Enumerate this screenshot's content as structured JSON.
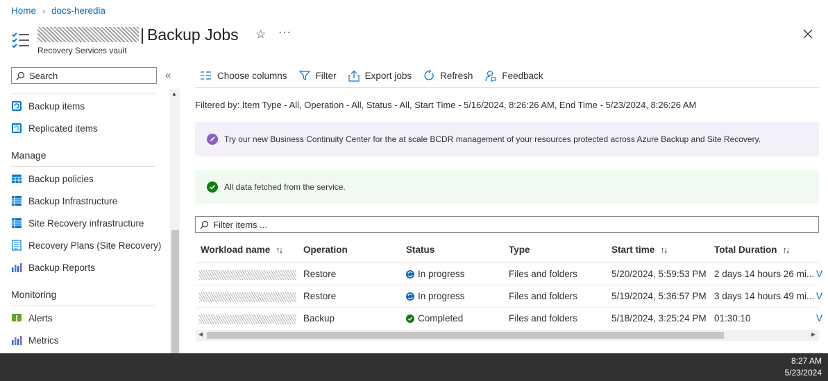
{
  "breadcrumb": {
    "home": "Home",
    "vault": "docs-heredia"
  },
  "header": {
    "title": "Backup Jobs",
    "separator": "|",
    "subtitle": "Recovery Services vault",
    "star_icon": "star-icon",
    "more_label": "···"
  },
  "sidebar": {
    "search_placeholder": "Search",
    "items_top": [
      {
        "label": "Backup items",
        "icon": "backup-items-icon"
      },
      {
        "label": "Replicated items",
        "icon": "replicated-items-icon"
      }
    ],
    "manage_header": "Manage",
    "manage_items": [
      {
        "label": "Backup policies",
        "icon": "policy-table-icon"
      },
      {
        "label": "Backup Infrastructure",
        "icon": "infrastructure-icon"
      },
      {
        "label": "Site Recovery infrastructure",
        "icon": "infrastructure-icon"
      },
      {
        "label": "Recovery Plans (Site Recovery)",
        "icon": "recovery-plan-icon"
      },
      {
        "label": "Backup Reports",
        "icon": "reports-chart-icon"
      }
    ],
    "monitoring_header": "Monitoring",
    "monitoring_items": [
      {
        "label": "Alerts",
        "icon": "alerts-icon"
      },
      {
        "label": "Metrics",
        "icon": "metrics-icon"
      }
    ]
  },
  "toolbar": {
    "choose_columns": "Choose columns",
    "filter": "Filter",
    "export_jobs": "Export jobs",
    "refresh": "Refresh",
    "feedback": "Feedback"
  },
  "filter_summary": "Filtered by: Item Type - All, Operation - All, Status - All, Start Time - 5/16/2024, 8:26:26 AM, End Time - 5/23/2024, 8:26:26 AM",
  "banners": {
    "bcc": "Try our new Business Continuity Center for the at scale BCDR management of your resources protected across Azure Backup and Site Recovery.",
    "fetched": "All data fetched from the service."
  },
  "filter_items_placeholder": "Filter items ...",
  "table": {
    "columns": [
      "Workload name",
      "Operation",
      "Status",
      "Type",
      "Start time",
      "Total Duration"
    ],
    "sort_glyph": "↑↓",
    "rows": [
      {
        "operation": "Restore",
        "status": "In progress",
        "status_icon": "in-progress-icon",
        "type": "Files and folders",
        "start": "5/20/2024, 5:59:53 PM",
        "duration": "2 days 14 hours 26 mi...",
        "link": "V"
      },
      {
        "operation": "Restore",
        "status": "In progress",
        "status_icon": "in-progress-icon",
        "type": "Files and folders",
        "start": "5/19/2024, 5:36:57 PM",
        "duration": "3 days 14 hours 49 mi...",
        "link": "V"
      },
      {
        "operation": "Backup",
        "status": "Completed",
        "status_icon": "completed-check-icon",
        "type": "Files and folders",
        "start": "5/18/2024, 3:25:24 PM",
        "duration": "01:30:10",
        "link": "V"
      }
    ]
  },
  "taskbar": {
    "time": "8:27 AM",
    "date": "5/23/2024"
  },
  "colors": {
    "link": "#0f6cbd",
    "purple_banner": "#f4f0f9",
    "green_banner": "#f1faf1",
    "success": "#107c10",
    "in_progress": "#0f6cbd"
  }
}
